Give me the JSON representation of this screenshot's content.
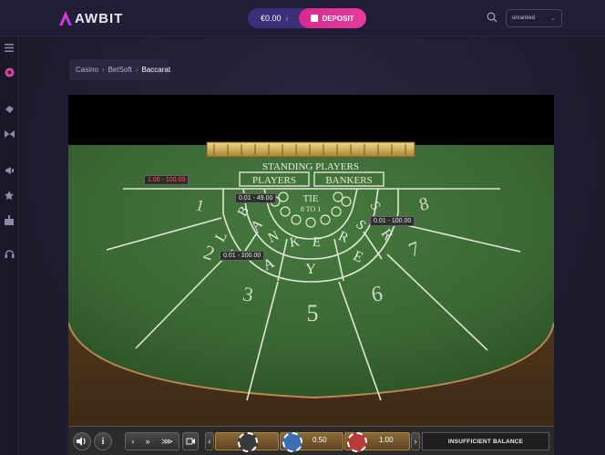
{
  "header": {
    "logo_text": "AWBIT",
    "balance": "€0.00",
    "deposit_label": "DEPOSIT",
    "rank_value": "unranked"
  },
  "breadcrumb": {
    "items": [
      "Casino",
      "BetSoft",
      "Baccarat"
    ]
  },
  "game": {
    "table": {
      "standing_players": "STANDING PLAYERS",
      "players": "PLAYERS",
      "bankers": "BANKERS",
      "tie": "TIE",
      "tie_odds": "8 TO 1",
      "banker_word": "BANKERS",
      "player_word": "PLAYER",
      "seats": [
        "1",
        "2",
        "3",
        "5",
        "6",
        "7",
        "8"
      ]
    },
    "limits": {
      "standing": "1.00 - 100.00",
      "tie": "0.01 - 49.00",
      "banker": "0.01 - 100.00",
      "player": "0.01 - 100.00"
    },
    "controls": {
      "chip_value_1": "0.50",
      "chip_value_2": "1.00",
      "status": "INSUFFICIENT BALANCE"
    }
  },
  "colors": {
    "accent_pink": "#e0338f",
    "wallet_purple": "#3a2f78",
    "felt_green": "#3c6b35",
    "line_white": "#dfe8d6"
  }
}
